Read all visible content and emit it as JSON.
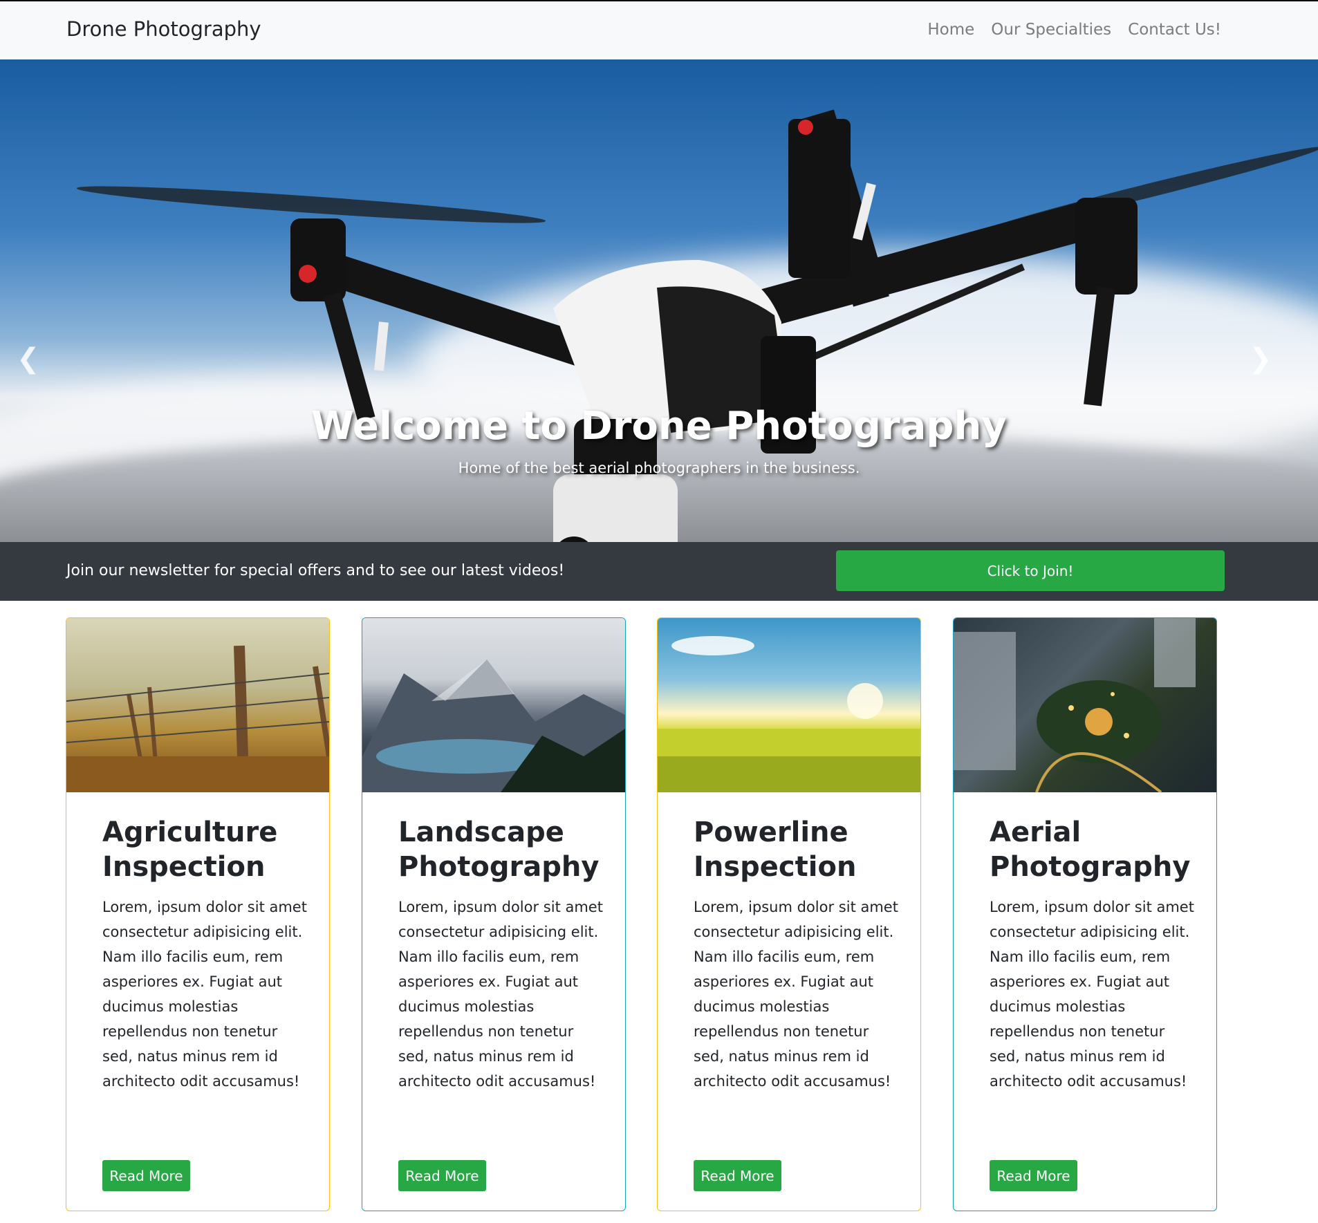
{
  "navbar": {
    "brand": "Drone Photography",
    "links": [
      "Home",
      "Our Specialties",
      "Contact Us!"
    ]
  },
  "hero": {
    "title": "Welcome to Drone Photography",
    "subtitle": "Home of the best aerial photographers in the business.",
    "prev_icon": "chevron-left-icon",
    "next_icon": "chevron-right-icon",
    "slide_count": 3,
    "active_slide": 1
  },
  "newsletter": {
    "message": "Join our newsletter for special offers and to see our latest videos!",
    "button": "Click to Join!"
  },
  "cards": [
    {
      "title": "Agriculture Inspection",
      "body": "Lorem, ipsum dolor sit amet consectetur adipisicing elit. Nam illo facilis eum, rem asperiores ex. Fugiat aut ducimus molestias repellendus non tenetur sed, natus minus rem id architecto odit accusamus!",
      "button": "Read More",
      "border_color": "#ffc107"
    },
    {
      "title": "Landscape Photography",
      "body": "Lorem, ipsum dolor sit amet consectetur adipisicing elit. Nam illo facilis eum, rem asperiores ex. Fugiat aut ducimus molestias repellendus non tenetur sed, natus minus rem id architecto odit accusamus!",
      "button": "Read More",
      "border_color": "#17a2b8"
    },
    {
      "title": "Powerline Inspection",
      "body": "Lorem, ipsum dolor sit amet consectetur adipisicing elit. Nam illo facilis eum, rem asperiores ex. Fugiat aut ducimus molestias repellendus non tenetur sed, natus minus rem id architecto odit accusamus!",
      "button": "Read More",
      "border_color": "#ffc107"
    },
    {
      "title": "Aerial Photography",
      "body": "Lorem, ipsum dolor sit amet consectetur adipisicing elit. Nam illo facilis eum, rem asperiores ex. Fugiat aut ducimus molestias repellendus non tenetur sed, natus minus rem id architecto odit accusamus!",
      "button": "Read More",
      "border_color": "#17a2b8"
    }
  ],
  "colors": {
    "accent_green": "#28a745",
    "dark_bar": "#343a40",
    "navbar_bg": "#f8f9fa"
  }
}
